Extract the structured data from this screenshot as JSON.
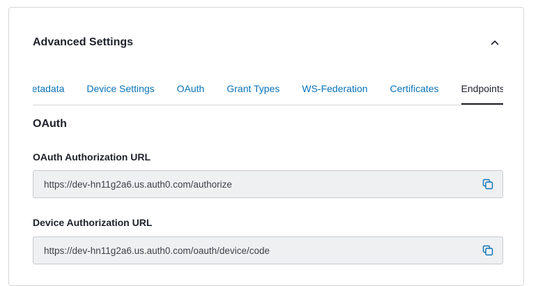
{
  "panel": {
    "title": "Advanced Settings"
  },
  "tabs": [
    {
      "label": "Metadata"
    },
    {
      "label": "Device Settings"
    },
    {
      "label": "OAuth"
    },
    {
      "label": "Grant Types"
    },
    {
      "label": "WS-Federation"
    },
    {
      "label": "Certificates"
    },
    {
      "label": "Endpoints"
    }
  ],
  "active_tab": "Endpoints",
  "section": {
    "title": "OAuth"
  },
  "fields": [
    {
      "label": "OAuth Authorization URL",
      "value": "https://dev-hn11g2a6.us.auth0.com/authorize"
    },
    {
      "label": "Device Authorization URL",
      "value": "https://dev-hn11g2a6.us.auth0.com/oauth/device/code"
    }
  ],
  "icons": {
    "collapse": "chevron-up-icon",
    "copy": "copy-icon"
  },
  "colors": {
    "tab_link": "#0a73b8",
    "copy_icon": "#0a73b8",
    "text": "#1e212a",
    "field_background": "#eff0f2"
  }
}
